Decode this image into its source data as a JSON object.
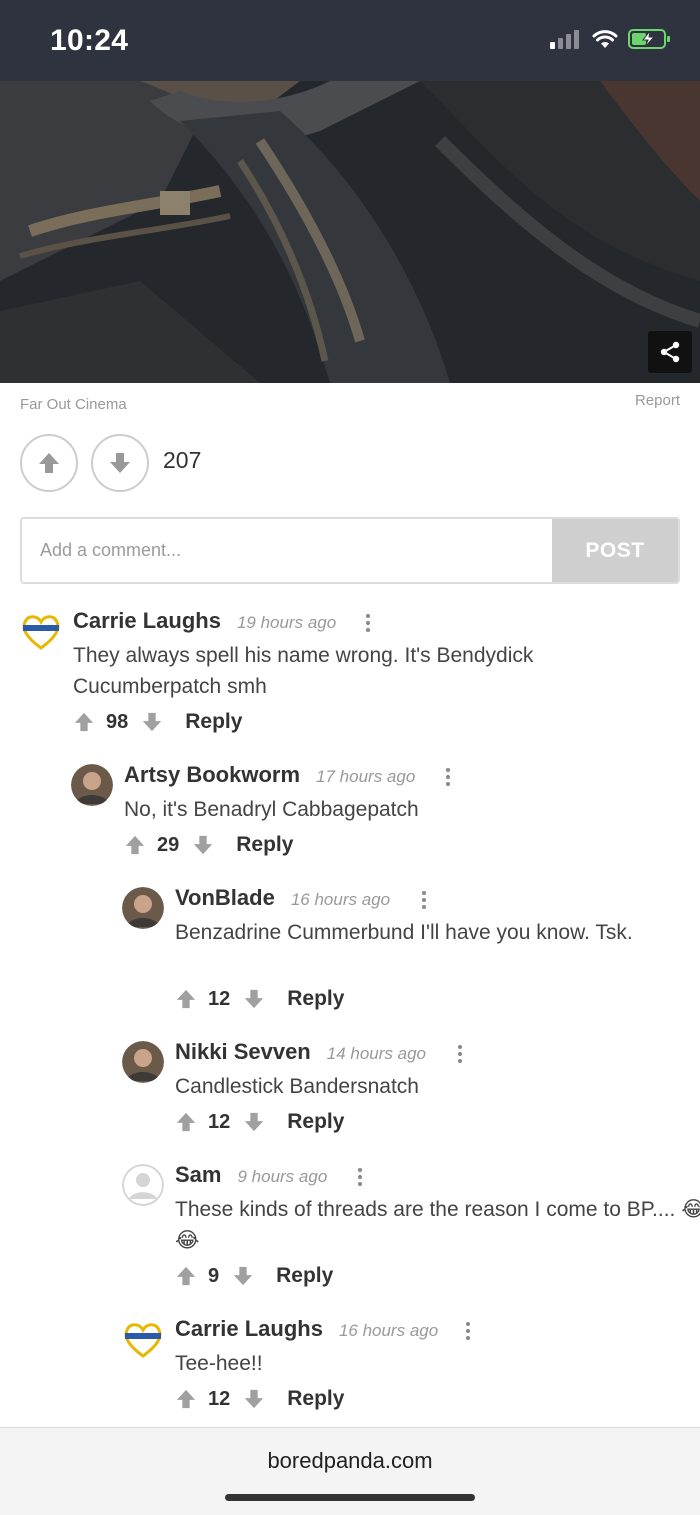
{
  "status": {
    "time": "10:24"
  },
  "post": {
    "source": "Far Out Cinema",
    "report_label": "Report",
    "votes": "207"
  },
  "comment_input": {
    "placeholder": "Add a comment...",
    "post_label": "POST"
  },
  "comments": [
    {
      "author": "Carrie Laughs",
      "time": "19 hours ago",
      "text": "They always spell his name wrong. It's Bendydick Cucumberpatch smh",
      "votes": "98",
      "reply": "Reply",
      "avatar": "heart-avatar"
    },
    {
      "author": "Artsy Bookworm",
      "time": "17 hours ago",
      "text": "No, it's Benadryl Cabbagepatch",
      "votes": "29",
      "reply": "Reply",
      "avatar": "photo-avatar"
    },
    {
      "author": "VonBlade",
      "time": "16 hours ago",
      "text": "Benzadrine Cummerbund I'll have you know. Tsk.",
      "votes": "12",
      "reply": "Reply",
      "avatar": "photo-avatar"
    },
    {
      "author": "Nikki Sevven",
      "time": "14 hours ago",
      "text": "Candlestick Bandersnatch",
      "votes": "12",
      "reply": "Reply",
      "avatar": "photo-avatar"
    },
    {
      "author": "Sam",
      "time": "9 hours ago",
      "text": "These kinds of threads are the reason I come to BP.... 😂😂",
      "votes": "9",
      "reply": "Reply",
      "avatar": "default-avatar"
    },
    {
      "author": "Carrie Laughs",
      "time": "16 hours ago",
      "text": "Tee-hee!!",
      "votes": "12",
      "reply": "Reply",
      "avatar": "heart-avatar"
    }
  ],
  "browser": {
    "url": "boredpanda.com"
  },
  "colors": {
    "status_bar": "#2f3340",
    "post_button": "#cfcfcf",
    "muted_text": "#999999"
  }
}
